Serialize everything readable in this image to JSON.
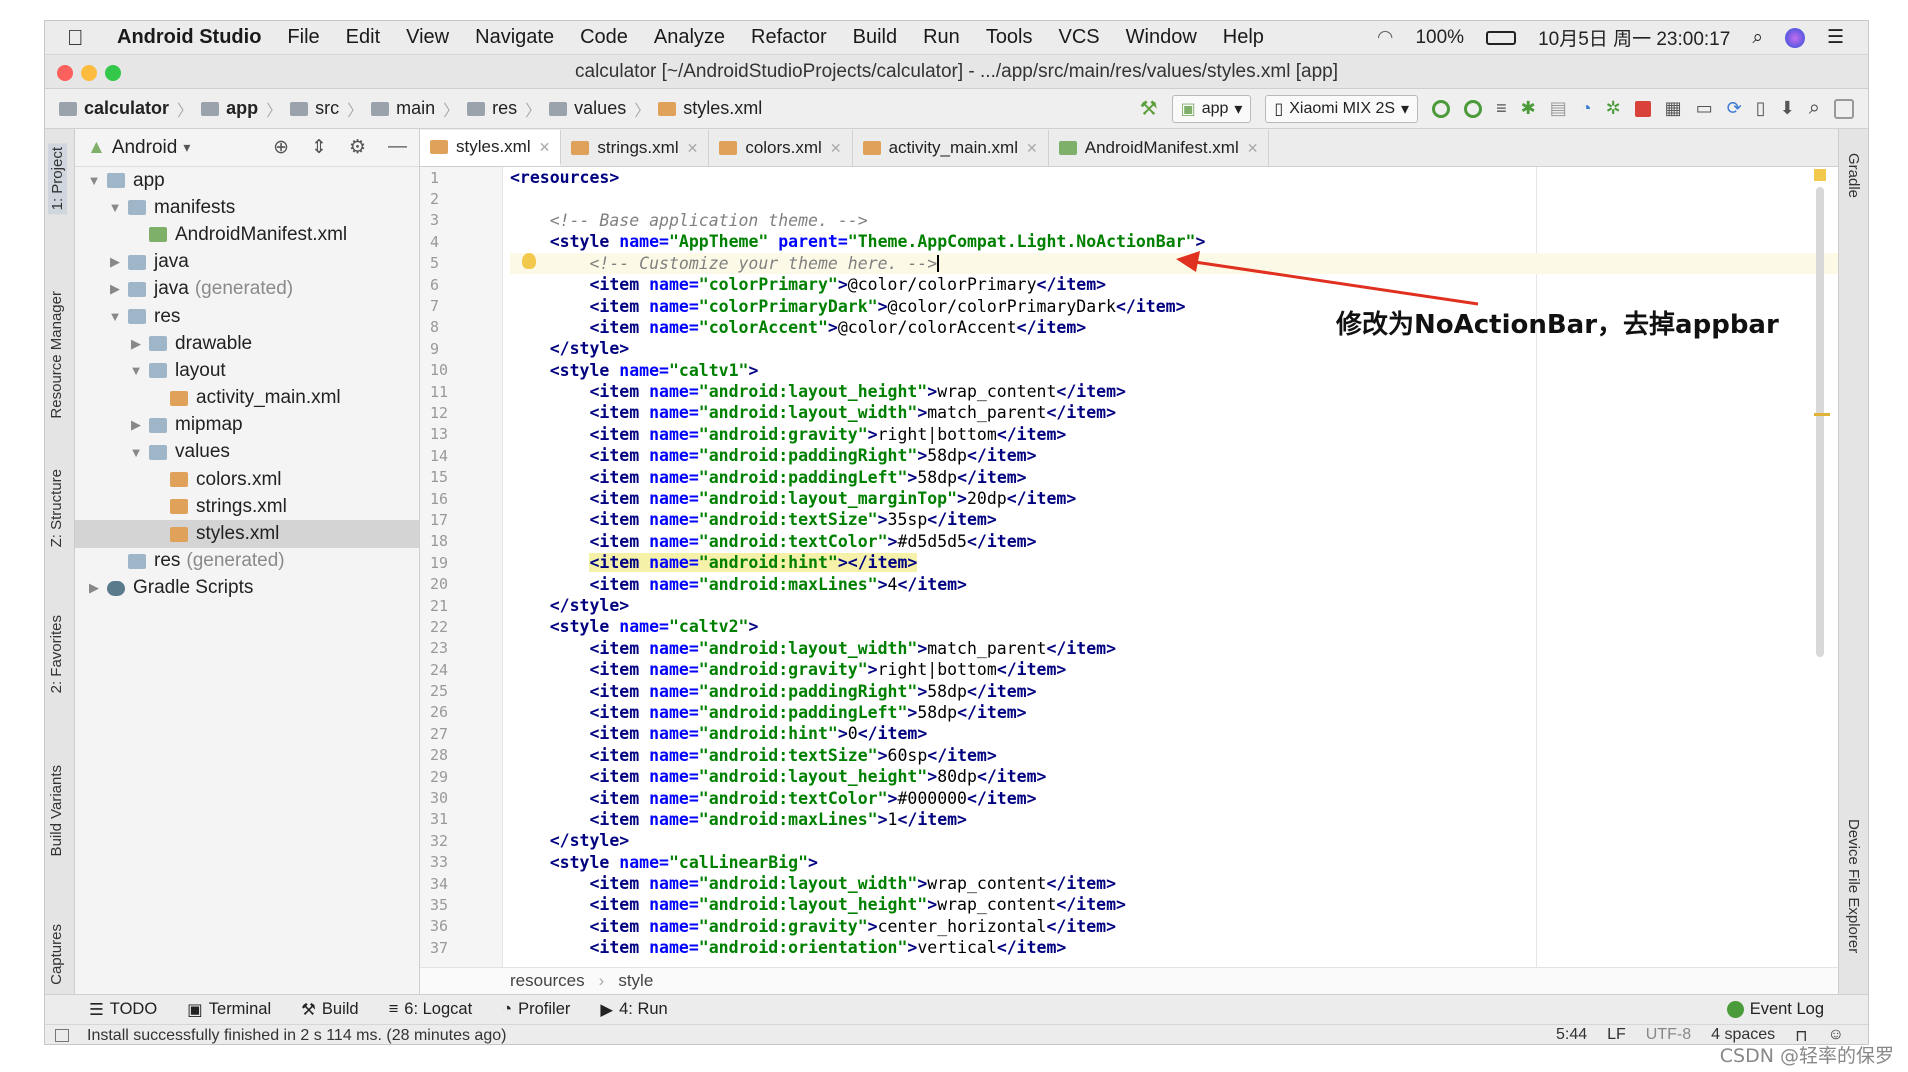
{
  "menubar": {
    "app": "Android Studio",
    "items": [
      "File",
      "Edit",
      "View",
      "Navigate",
      "Code",
      "Analyze",
      "Refactor",
      "Build",
      "Run",
      "Tools",
      "VCS",
      "Window",
      "Help"
    ],
    "battery": "100%",
    "clock": "10月5日 周一 23:00:17"
  },
  "window": {
    "title": "calculator [~/AndroidStudioProjects/calculator] - .../app/src/main/res/values/styles.xml [app]"
  },
  "breadcrumb": [
    "calculator",
    "app",
    "src",
    "main",
    "res",
    "values",
    "styles.xml"
  ],
  "toolbar": {
    "module": "app",
    "device": "Xiaomi MIX 2S"
  },
  "project": {
    "view": "Android",
    "tree": [
      {
        "label": "app",
        "depth": 0,
        "arrow": "▼",
        "icon": "fold"
      },
      {
        "label": "manifests",
        "depth": 1,
        "arrow": "▼",
        "icon": "fold"
      },
      {
        "label": "AndroidManifest.xml",
        "depth": 2,
        "arrow": "",
        "icon": "mf"
      },
      {
        "label": "java",
        "depth": 1,
        "arrow": "▶",
        "icon": "fold"
      },
      {
        "label": "java",
        "suffix": "(generated)",
        "depth": 1,
        "arrow": "▶",
        "icon": "fold"
      },
      {
        "label": "res",
        "depth": 1,
        "arrow": "▼",
        "icon": "fold"
      },
      {
        "label": "drawable",
        "depth": 2,
        "arrow": "▶",
        "icon": "fold"
      },
      {
        "label": "layout",
        "depth": 2,
        "arrow": "▼",
        "icon": "fold"
      },
      {
        "label": "activity_main.xml",
        "depth": 3,
        "arrow": "",
        "icon": "xml"
      },
      {
        "label": "mipmap",
        "depth": 2,
        "arrow": "▶",
        "icon": "fold"
      },
      {
        "label": "values",
        "depth": 2,
        "arrow": "▼",
        "icon": "fold"
      },
      {
        "label": "colors.xml",
        "depth": 3,
        "arrow": "",
        "icon": "xml"
      },
      {
        "label": "strings.xml",
        "depth": 3,
        "arrow": "",
        "icon": "xml"
      },
      {
        "label": "styles.xml",
        "depth": 3,
        "arrow": "",
        "icon": "xml",
        "selected": true
      },
      {
        "label": "res",
        "suffix": "(generated)",
        "depth": 1,
        "arrow": "",
        "icon": "fold"
      },
      {
        "label": "Gradle Scripts",
        "depth": 0,
        "arrow": "▶",
        "icon": "grad"
      }
    ]
  },
  "left_stripe": [
    "1: Project",
    "Resource Manager",
    "Z: Structure",
    "2: Favorites",
    "Build Variants",
    "Captures"
  ],
  "right_stripe": [
    "Gradle",
    "Device File Explorer"
  ],
  "tabs": [
    {
      "label": "styles.xml",
      "icon": "xml",
      "active": true
    },
    {
      "label": "strings.xml",
      "icon": "xml"
    },
    {
      "label": "colors.xml",
      "icon": "xml"
    },
    {
      "label": "activity_main.xml",
      "icon": "xml"
    },
    {
      "label": "AndroidManifest.xml",
      "icon": "mf"
    }
  ],
  "code": [
    {
      "n": 1,
      "ind": "",
      "t": [
        [
          "tg",
          "<resources>"
        ]
      ]
    },
    {
      "n": 2,
      "ind": "",
      "t": []
    },
    {
      "n": 3,
      "ind": "    ",
      "t": [
        [
          "cm",
          "<!-- Base application theme. -->"
        ]
      ]
    },
    {
      "n": 4,
      "ind": "    ",
      "t": [
        [
          "tg",
          "<style "
        ],
        [
          "an",
          "name="
        ],
        [
          "av",
          "\"AppTheme\" "
        ],
        [
          "an",
          "parent="
        ],
        [
          "av",
          "\"Theme.AppCompat.Light.NoActionBar\""
        ],
        [
          "tg",
          ">"
        ]
      ]
    },
    {
      "n": 5,
      "ind": "        ",
      "t": [
        [
          "cm",
          "<!-- Customize your theme here. -->"
        ]
      ],
      "cur": true
    },
    {
      "n": 6,
      "ind": "        ",
      "t": [
        [
          "tg",
          "<item "
        ],
        [
          "an",
          "name="
        ],
        [
          "av",
          "\"colorPrimary\""
        ],
        [
          "tg",
          ">"
        ],
        [
          "tx",
          "@color/colorPrimary"
        ],
        [
          "tg",
          "</item>"
        ]
      ]
    },
    {
      "n": 7,
      "ind": "        ",
      "t": [
        [
          "tg",
          "<item "
        ],
        [
          "an",
          "name="
        ],
        [
          "av",
          "\"colorPrimaryDark\""
        ],
        [
          "tg",
          ">"
        ],
        [
          "tx",
          "@color/colorPrimaryDark"
        ],
        [
          "tg",
          "</item>"
        ]
      ]
    },
    {
      "n": 8,
      "ind": "        ",
      "t": [
        [
          "tg",
          "<item "
        ],
        [
          "an",
          "name="
        ],
        [
          "av",
          "\"colorAccent\""
        ],
        [
          "tg",
          ">"
        ],
        [
          "tx",
          "@color/colorAccent"
        ],
        [
          "tg",
          "</item>"
        ]
      ]
    },
    {
      "n": 9,
      "ind": "    ",
      "t": [
        [
          "tg",
          "</style>"
        ]
      ]
    },
    {
      "n": 10,
      "ind": "    ",
      "t": [
        [
          "tg",
          "<style "
        ],
        [
          "an",
          "name="
        ],
        [
          "av",
          "\"caltv1\""
        ],
        [
          "tg",
          ">"
        ]
      ]
    },
    {
      "n": 11,
      "ind": "        ",
      "t": [
        [
          "tg",
          "<item "
        ],
        [
          "an",
          "name="
        ],
        [
          "av",
          "\"android:layout_height\""
        ],
        [
          "tg",
          ">"
        ],
        [
          "tx",
          "wrap_content"
        ],
        [
          "tg",
          "</item>"
        ]
      ]
    },
    {
      "n": 12,
      "ind": "        ",
      "t": [
        [
          "tg",
          "<item "
        ],
        [
          "an",
          "name="
        ],
        [
          "av",
          "\"android:layout_width\""
        ],
        [
          "tg",
          ">"
        ],
        [
          "tx",
          "match_parent"
        ],
        [
          "tg",
          "</item>"
        ]
      ]
    },
    {
      "n": 13,
      "ind": "        ",
      "t": [
        [
          "tg",
          "<item "
        ],
        [
          "an",
          "name="
        ],
        [
          "av",
          "\"android:gravity\""
        ],
        [
          "tg",
          ">"
        ],
        [
          "tx",
          "right|bottom"
        ],
        [
          "tg",
          "</item>"
        ]
      ]
    },
    {
      "n": 14,
      "ind": "        ",
      "t": [
        [
          "tg",
          "<item "
        ],
        [
          "an",
          "name="
        ],
        [
          "av",
          "\"android:paddingRight\""
        ],
        [
          "tg",
          ">"
        ],
        [
          "tx",
          "58dp"
        ],
        [
          "tg",
          "</item>"
        ]
      ]
    },
    {
      "n": 15,
      "ind": "        ",
      "t": [
        [
          "tg",
          "<item "
        ],
        [
          "an",
          "name="
        ],
        [
          "av",
          "\"android:paddingLeft\""
        ],
        [
          "tg",
          ">"
        ],
        [
          "tx",
          "58dp"
        ],
        [
          "tg",
          "</item>"
        ]
      ]
    },
    {
      "n": 16,
      "ind": "        ",
      "t": [
        [
          "tg",
          "<item "
        ],
        [
          "an",
          "name="
        ],
        [
          "av",
          "\"android:layout_marginTop\""
        ],
        [
          "tg",
          ">"
        ],
        [
          "tx",
          "20dp"
        ],
        [
          "tg",
          "</item>"
        ]
      ]
    },
    {
      "n": 17,
      "ind": "        ",
      "t": [
        [
          "tg",
          "<item "
        ],
        [
          "an",
          "name="
        ],
        [
          "av",
          "\"android:textSize\""
        ],
        [
          "tg",
          ">"
        ],
        [
          "tx",
          "35sp"
        ],
        [
          "tg",
          "</item>"
        ]
      ]
    },
    {
      "n": 18,
      "ind": "        ",
      "t": [
        [
          "tg",
          "<item "
        ],
        [
          "an",
          "name="
        ],
        [
          "av",
          "\"android:textColor\""
        ],
        [
          "tg",
          ">"
        ],
        [
          "tx",
          "#d5d5d5"
        ],
        [
          "tg",
          "</item>"
        ]
      ]
    },
    {
      "n": 19,
      "ind": "        ",
      "t": [
        [
          "tg",
          "<item "
        ],
        [
          "an",
          "name="
        ],
        [
          "av",
          "\"android:hint\""
        ],
        [
          "tg",
          ">"
        ],
        [
          "tg",
          "</item>"
        ]
      ],
      "hl": true
    },
    {
      "n": 20,
      "ind": "        ",
      "t": [
        [
          "tg",
          "<item "
        ],
        [
          "an",
          "name="
        ],
        [
          "av",
          "\"android:maxLines\""
        ],
        [
          "tg",
          ">"
        ],
        [
          "tx",
          "4"
        ],
        [
          "tg",
          "</item>"
        ]
      ]
    },
    {
      "n": 21,
      "ind": "    ",
      "t": [
        [
          "tg",
          "</style>"
        ]
      ]
    },
    {
      "n": 22,
      "ind": "    ",
      "t": [
        [
          "tg",
          "<style "
        ],
        [
          "an",
          "name="
        ],
        [
          "av",
          "\"caltv2\""
        ],
        [
          "tg",
          ">"
        ]
      ]
    },
    {
      "n": 23,
      "ind": "        ",
      "t": [
        [
          "tg",
          "<item "
        ],
        [
          "an",
          "name="
        ],
        [
          "av",
          "\"android:layout_width\""
        ],
        [
          "tg",
          ">"
        ],
        [
          "tx",
          "match_parent"
        ],
        [
          "tg",
          "</item>"
        ]
      ]
    },
    {
      "n": 24,
      "ind": "        ",
      "t": [
        [
          "tg",
          "<item "
        ],
        [
          "an",
          "name="
        ],
        [
          "av",
          "\"android:gravity\""
        ],
        [
          "tg",
          ">"
        ],
        [
          "tx",
          "right|bottom"
        ],
        [
          "tg",
          "</item>"
        ]
      ]
    },
    {
      "n": 25,
      "ind": "        ",
      "t": [
        [
          "tg",
          "<item "
        ],
        [
          "an",
          "name="
        ],
        [
          "av",
          "\"android:paddingRight\""
        ],
        [
          "tg",
          ">"
        ],
        [
          "tx",
          "58dp"
        ],
        [
          "tg",
          "</item>"
        ]
      ]
    },
    {
      "n": 26,
      "ind": "        ",
      "t": [
        [
          "tg",
          "<item "
        ],
        [
          "an",
          "name="
        ],
        [
          "av",
          "\"android:paddingLeft\""
        ],
        [
          "tg",
          ">"
        ],
        [
          "tx",
          "58dp"
        ],
        [
          "tg",
          "</item>"
        ]
      ]
    },
    {
      "n": 27,
      "ind": "        ",
      "t": [
        [
          "tg",
          "<item "
        ],
        [
          "an",
          "name="
        ],
        [
          "av",
          "\"android:hint\""
        ],
        [
          "tg",
          ">"
        ],
        [
          "tx",
          "0"
        ],
        [
          "tg",
          "</item>"
        ]
      ]
    },
    {
      "n": 28,
      "ind": "        ",
      "t": [
        [
          "tg",
          "<item "
        ],
        [
          "an",
          "name="
        ],
        [
          "av",
          "\"android:textSize\""
        ],
        [
          "tg",
          ">"
        ],
        [
          "tx",
          "60sp"
        ],
        [
          "tg",
          "</item>"
        ]
      ]
    },
    {
      "n": 29,
      "ind": "        ",
      "t": [
        [
          "tg",
          "<item "
        ],
        [
          "an",
          "name="
        ],
        [
          "av",
          "\"android:layout_height\""
        ],
        [
          "tg",
          ">"
        ],
        [
          "tx",
          "80dp"
        ],
        [
          "tg",
          "</item>"
        ]
      ]
    },
    {
      "n": 30,
      "ind": "        ",
      "t": [
        [
          "tg",
          "<item "
        ],
        [
          "an",
          "name="
        ],
        [
          "av",
          "\"android:textColor\""
        ],
        [
          "tg",
          ">"
        ],
        [
          "tx",
          "#000000"
        ],
        [
          "tg",
          "</item>"
        ]
      ]
    },
    {
      "n": 31,
      "ind": "        ",
      "t": [
        [
          "tg",
          "<item "
        ],
        [
          "an",
          "name="
        ],
        [
          "av",
          "\"android:maxLines\""
        ],
        [
          "tg",
          ">"
        ],
        [
          "tx",
          "1"
        ],
        [
          "tg",
          "</item>"
        ]
      ]
    },
    {
      "n": 32,
      "ind": "    ",
      "t": [
        [
          "tg",
          "</style>"
        ]
      ]
    },
    {
      "n": 33,
      "ind": "    ",
      "t": [
        [
          "tg",
          "<style "
        ],
        [
          "an",
          "name="
        ],
        [
          "av",
          "\"calLinearBig\""
        ],
        [
          "tg",
          ">"
        ]
      ]
    },
    {
      "n": 34,
      "ind": "        ",
      "t": [
        [
          "tg",
          "<item "
        ],
        [
          "an",
          "name="
        ],
        [
          "av",
          "\"android:layout_width\""
        ],
        [
          "tg",
          ">"
        ],
        [
          "tx",
          "wrap_content"
        ],
        [
          "tg",
          "</item>"
        ]
      ]
    },
    {
      "n": 35,
      "ind": "        ",
      "t": [
        [
          "tg",
          "<item "
        ],
        [
          "an",
          "name="
        ],
        [
          "av",
          "\"android:layout_height\""
        ],
        [
          "tg",
          ">"
        ],
        [
          "tx",
          "wrap_content"
        ],
        [
          "tg",
          "</item>"
        ]
      ]
    },
    {
      "n": 36,
      "ind": "        ",
      "t": [
        [
          "tg",
          "<item "
        ],
        [
          "an",
          "name="
        ],
        [
          "av",
          "\"android:gravity\""
        ],
        [
          "tg",
          ">"
        ],
        [
          "tx",
          "center_horizontal"
        ],
        [
          "tg",
          "</item>"
        ]
      ]
    },
    {
      "n": 37,
      "ind": "        ",
      "t": [
        [
          "tg",
          "<item "
        ],
        [
          "an",
          "name="
        ],
        [
          "av",
          "\"android:orientation\""
        ],
        [
          "tg",
          ">"
        ],
        [
          "tx",
          "vertical"
        ],
        [
          "tg",
          "</item>"
        ]
      ]
    }
  ],
  "gutter_marks": {
    "8": "#cc3366",
    "18": "#dddddd",
    "30": "#000000"
  },
  "editor_breadcrumb": [
    "resources",
    "style"
  ],
  "tool_windows": [
    "TODO",
    "Terminal",
    "Build",
    "6: Logcat",
    "Profiler",
    "4: Run"
  ],
  "event_log": "Event Log",
  "status": {
    "message": "Install successfully finished in 2 s 114 ms. (28 minutes ago)",
    "position": "5:44",
    "line_sep": "LF",
    "encoding": "UTF-8",
    "indent": "4 spaces"
  },
  "annotation": "修改为NoActionBar，去掉appbar",
  "watermark": "CSDN @轻率的保罗",
  "colors": {
    "tag": "#000080",
    "attr": "#0000ff",
    "value": "#008000",
    "comment": "#808080",
    "arrow": "#e03020"
  }
}
